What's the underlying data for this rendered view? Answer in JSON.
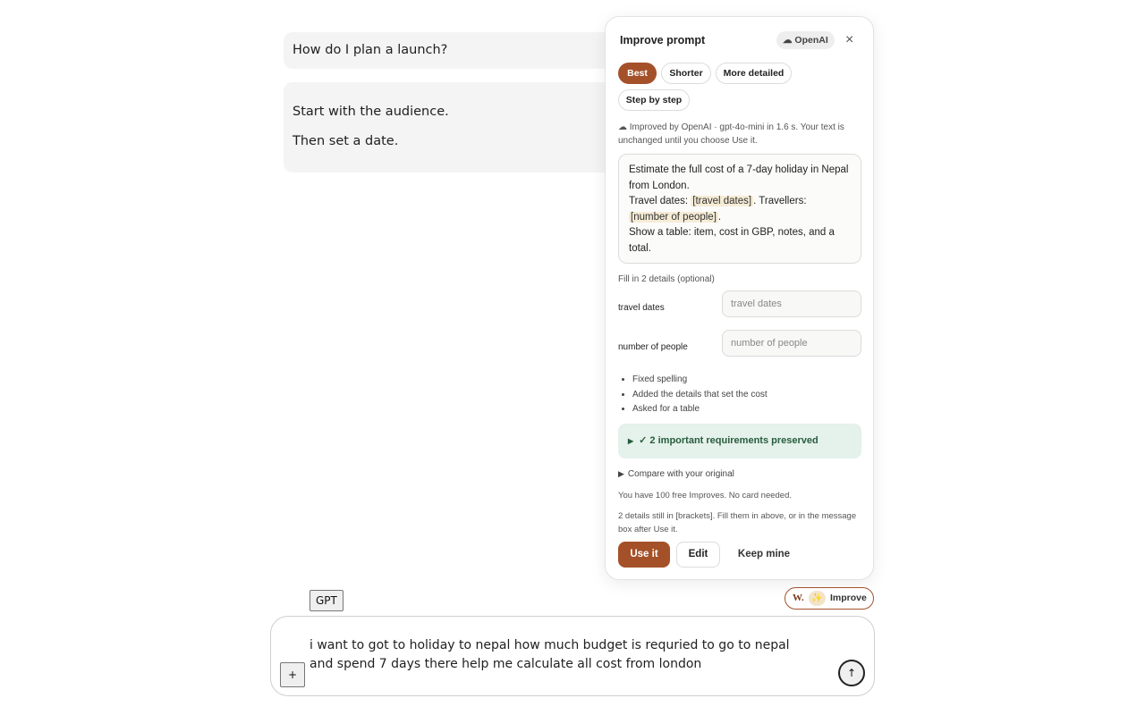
{
  "chat": {
    "user_message": "How do I plan a launch?",
    "assistant_lines": [
      "Start with the audience.",
      "Then set a date."
    ]
  },
  "panel": {
    "title": "Improve prompt",
    "provider_icon": "cloud-icon",
    "provider_label": "☁ OpenAI",
    "close_label": "×",
    "chips": {
      "best": "Best",
      "shorter": "Shorter",
      "more_detailed": "More detailed",
      "step_by_step": "Step by step"
    },
    "active_chip": "Best",
    "meta": "☁ Improved by OpenAI · gpt-4o-mini in 1.6 s. Your text is unchanged until you choose Use it.",
    "output": {
      "line1": "Estimate the full cost of a 7-day holiday in Nepal from London.",
      "line2_prefix": "Travel dates:",
      "placeholder1": "[travel dates]",
      "line2_suffix": ". Travellers:",
      "placeholder2": "[number of people]",
      "line3_suffix": ".",
      "line4": "Show a table: item, cost in GBP, notes, and a total."
    },
    "fill_title": "Fill in 2 details (optional)",
    "fields": {
      "travel_dates_label": "travel dates",
      "travel_dates_placeholder": "travel dates",
      "people_label": "number of people",
      "people_placeholder": "number of people"
    },
    "changes": [
      "Fixed spelling",
      "Added the details that set the cost",
      "Asked for a table"
    ],
    "preserved_label": "✓ 2 important requirements preserved",
    "compare_label": "Compare with your original",
    "free_note": "You have 100 free Improves. No card needed.",
    "brackets_note": "2 details still in [brackets]. Fill them in above, or in the message box after Use it.",
    "buttons": {
      "use": "Use it",
      "edit": "Edit",
      "keep": "Keep mine"
    }
  },
  "composer": {
    "model_label": "GPT",
    "improve_badge": "W.",
    "improve_label": "Improve",
    "message": "i want to got to holiday to nepal how much budget is requried to go to nepal and spend 7 days there help me calculate all cost from london",
    "plus_label": "+",
    "send_label": "↑"
  }
}
